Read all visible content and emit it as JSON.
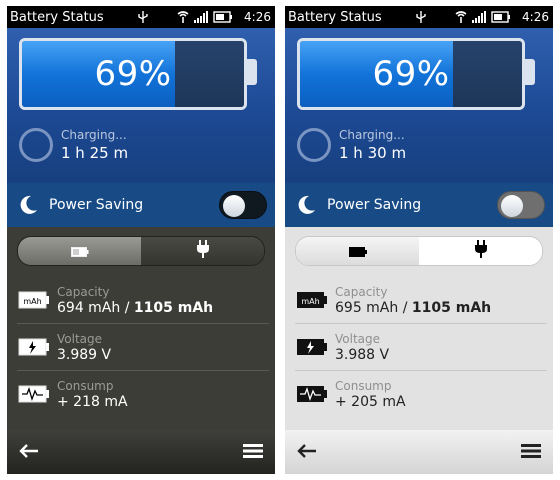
{
  "phones": [
    {
      "theme": "dark",
      "statusbar": {
        "title": "Battery Status",
        "time": "4:26"
      },
      "battery": {
        "percent_label": "69%",
        "level": 0.69
      },
      "charging": {
        "label": "Charging...",
        "time": "1 h 25 m"
      },
      "power_saving": {
        "label": "Power Saving",
        "enabled": false
      },
      "segmented": {
        "selected": "battery-tab"
      },
      "capacity": {
        "label": "Capacity",
        "current": "694 mAh",
        "separator": " / ",
        "total": "1105 mAh"
      },
      "voltage": {
        "label": "Voltage",
        "value": "3.989 V"
      },
      "consump": {
        "label": "Consump",
        "value": "+ 218 mA"
      },
      "colors": {
        "accent": "#1c4892",
        "fill": "#1273d9"
      },
      "icons": [
        "usb-icon",
        "wifi-icon",
        "signal-icon",
        "battery-icon",
        "moon-icon",
        "plug-icon",
        "back-arrow-icon",
        "menu-icon"
      ]
    },
    {
      "theme": "light",
      "statusbar": {
        "title": "Battery Status",
        "time": "4:26"
      },
      "battery": {
        "percent_label": "69%",
        "level": 0.69
      },
      "charging": {
        "label": "Charging...",
        "time": "1 h 30 m"
      },
      "power_saving": {
        "label": "Power Saving",
        "enabled": false
      },
      "segmented": {
        "selected": "charger-tab"
      },
      "capacity": {
        "label": "Capacity",
        "current": "695 mAh",
        "separator": " / ",
        "total": "1105 mAh"
      },
      "voltage": {
        "label": "Voltage",
        "value": "3.988 V"
      },
      "consump": {
        "label": "Consump",
        "value": "+ 205 mA"
      },
      "colors": {
        "accent": "#1c4892",
        "fill": "#1273d9"
      },
      "icons": [
        "usb-icon",
        "wifi-icon",
        "signal-icon",
        "battery-icon",
        "moon-icon",
        "plug-icon",
        "back-arrow-icon",
        "menu-icon"
      ]
    }
  ],
  "capacity_icon_text": "mAh"
}
